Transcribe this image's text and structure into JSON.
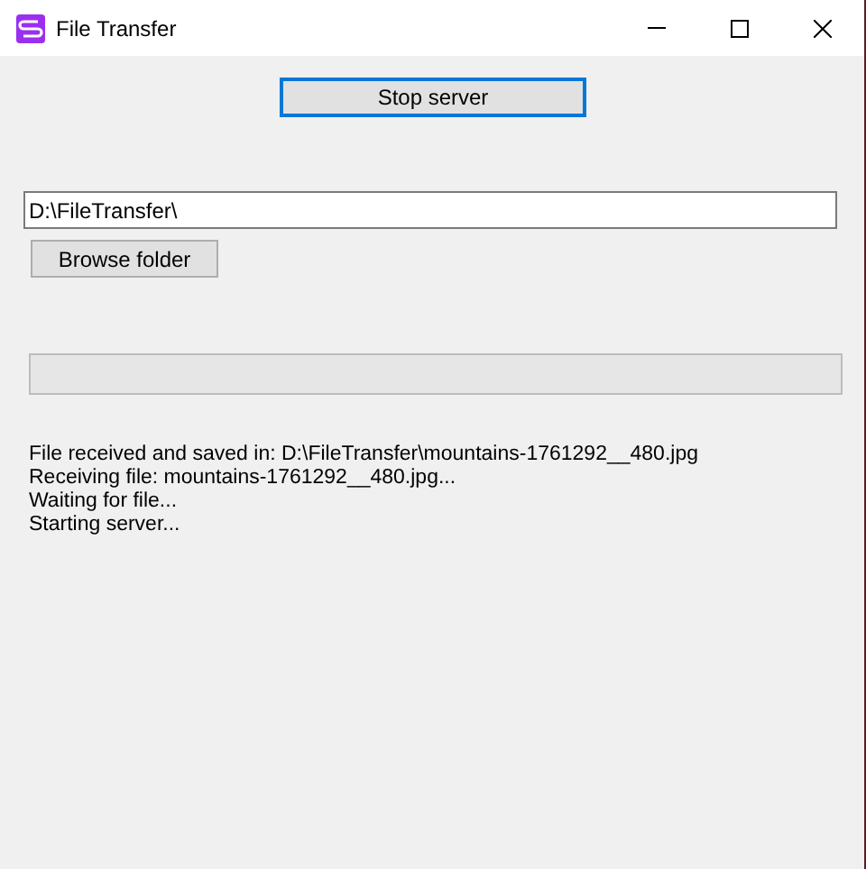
{
  "window": {
    "title": "File Transfer"
  },
  "stop_button": {
    "label": "Stop server",
    "focused": true
  },
  "folder_field": {
    "value": "D:\\FileTransfer\\"
  },
  "browse_button": {
    "label": "Browse folder"
  },
  "progress": {
    "level": 0
  },
  "log": [
    "File received and saved in: D:\\FileTransfer\\mountains-1761292__480.jpg",
    "Receiving file: mountains-1761292__480.jpg...",
    "Waiting for file...",
    "Starting server..."
  ]
}
